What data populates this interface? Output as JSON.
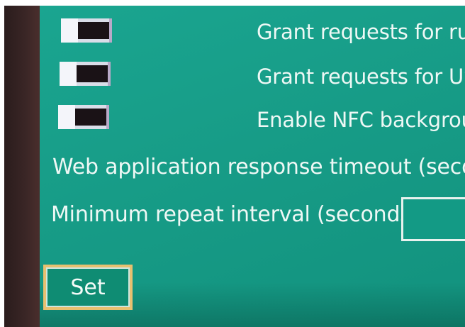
{
  "settings": {
    "toggles": [
      {
        "label": "Grant requests for ru"
      },
      {
        "label": "Grant requests for US"
      },
      {
        "label": "Enable NFC backgrou"
      }
    ],
    "web_timeout_label": "Web application response timeout (secon",
    "repeat_interval_label": "Minimum repeat interval (seconds)",
    "repeat_interval_value": ""
  },
  "actions": {
    "set_label": "Set"
  },
  "colors": {
    "screen": "#179c87",
    "button_border": "#e7c070",
    "toggle_track": "#1a1216"
  }
}
